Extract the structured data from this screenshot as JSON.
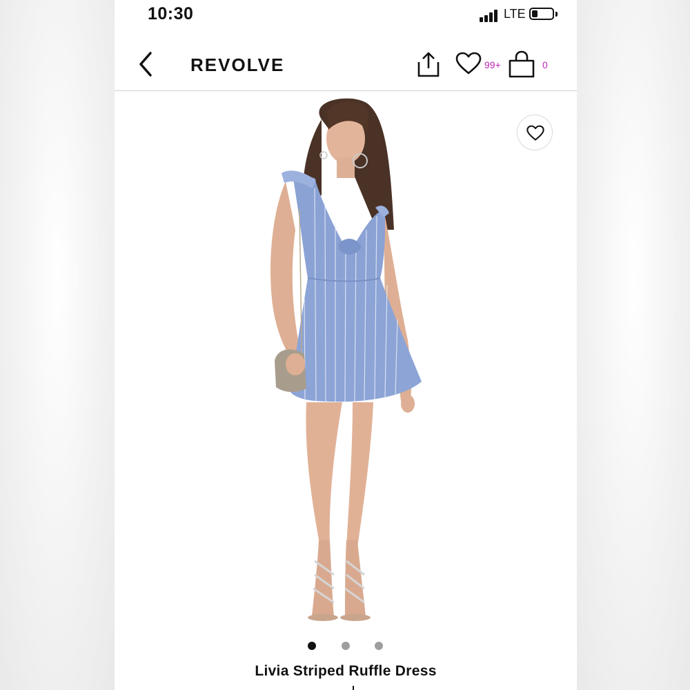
{
  "status_bar": {
    "time": "10:30",
    "network": "LTE",
    "battery_level": 0.3
  },
  "nav": {
    "back_icon": "chevron-left-icon",
    "brand": "REVOLVE",
    "share_icon": "share-icon",
    "wishlist_icon": "heart-outline-icon",
    "wishlist_count": "99+",
    "bag_icon": "shopping-bag-icon",
    "bag_count": "0",
    "badge_color": "#c026b8"
  },
  "product": {
    "image_icon": "product-photo",
    "favorite_icon": "heart-outline-icon",
    "carousel": {
      "total": 3,
      "active_index": 0,
      "active_color": "#111111",
      "inactive_color": "#9e9e9e"
    },
    "title": "Livia Striped Ruffle Dress"
  }
}
